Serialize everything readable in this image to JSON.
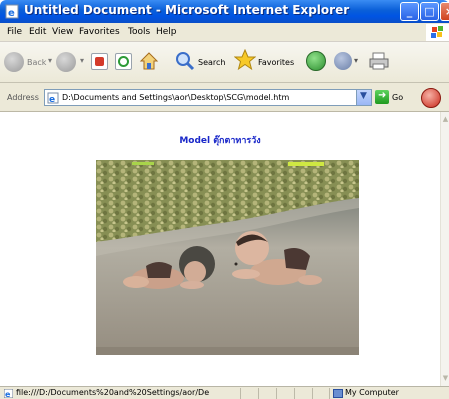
{
  "window": {
    "title": "Untitled Document - Microsoft Internet Explorer"
  },
  "menu": [
    "File",
    "Edit",
    "View",
    "Favorites",
    "Tools",
    "Help"
  ],
  "toolbar": {
    "back_label": "Back",
    "search_label": "Search",
    "favorites_label": "Favorites"
  },
  "address": {
    "label": "Address",
    "url": "D:\\Documents and Settings\\aor\\Desktop\\SCG\\model.htm",
    "go_label": "Go"
  },
  "page": {
    "heading": "Model ตุ๊กตาทารวัง"
  },
  "status": {
    "text": "file:///D:/Documents%20and%20Settings/aor/De",
    "zone": "My Computer"
  },
  "colors": {
    "titlebar": "#0054e3",
    "heading": "#1a28c9",
    "chrome": "#ece9d8"
  }
}
